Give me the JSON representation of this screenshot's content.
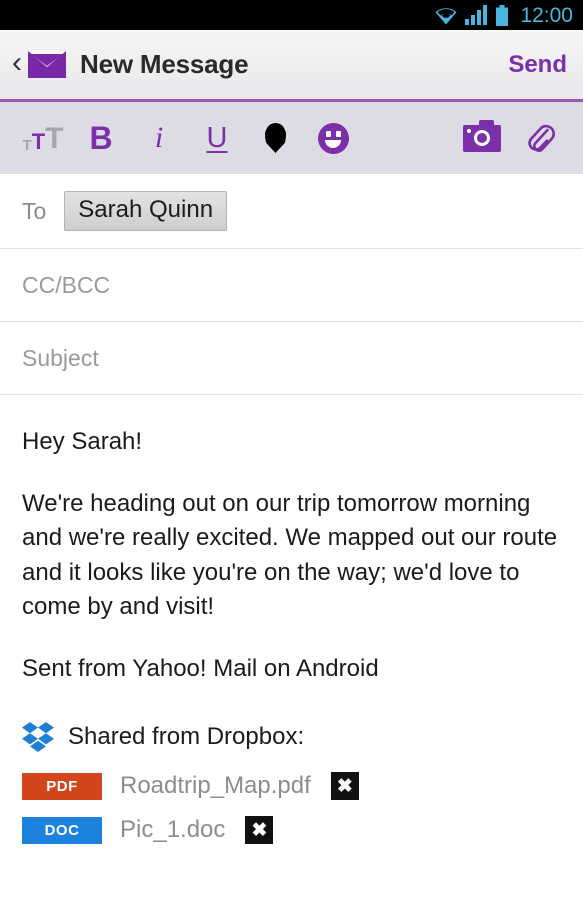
{
  "statusbar": {
    "time": "12:00",
    "icons": [
      "wifi-icon",
      "signal-icon",
      "battery-icon"
    ],
    "accent_color": "#49b6e0",
    "background_color": "#000000"
  },
  "header": {
    "back_label": "‹",
    "app_icon": "envelope-icon",
    "title": "New Message",
    "send_label": "Send",
    "accent_color": "#7b2fa8",
    "underline_color": "#9b59b6"
  },
  "toolbar": {
    "background_color": "#dddce4",
    "items": [
      {
        "name": "font-size-icon",
        "label": "TtT",
        "small": "T",
        "medium": "T",
        "large": "T"
      },
      {
        "name": "bold-icon",
        "label": "B"
      },
      {
        "name": "italic-icon",
        "label": "i"
      },
      {
        "name": "underline-icon",
        "label": "U"
      },
      {
        "name": "text-color-drop-icon",
        "label": ""
      },
      {
        "name": "emoji-icon",
        "label": ""
      },
      {
        "name": "camera-icon",
        "label": ""
      },
      {
        "name": "attachment-paperclip-icon",
        "label": ""
      }
    ]
  },
  "compose": {
    "to": {
      "label": "To",
      "recipients": [
        "Sarah Quinn"
      ],
      "placeholder": "To"
    },
    "cc_bcc": {
      "placeholder": "CC/BCC",
      "value": ""
    },
    "subject": {
      "placeholder": "Subject",
      "value": ""
    },
    "body": {
      "paragraphs": [
        "Hey Sarah!",
        "We're heading out on our trip tomorrow morning and we're really excited. We mapped out our route and it looks like you're on the way; we'd love to come by and visit!",
        "Sent from Yahoo! Mail on Android"
      ]
    }
  },
  "dropbox": {
    "icon": "dropbox-logo-icon",
    "title": "Shared from Dropbox:",
    "brand_color": "#1e7fd4",
    "attachments": [
      {
        "type": "PDF",
        "name": "Roadtrip_Map.pdf",
        "badge_color": "#d3451d",
        "remove_label": "✖"
      },
      {
        "type": "DOC",
        "name": "Pic_1.doc",
        "badge_color": "#1c83dd",
        "remove_label": "✖"
      }
    ]
  }
}
